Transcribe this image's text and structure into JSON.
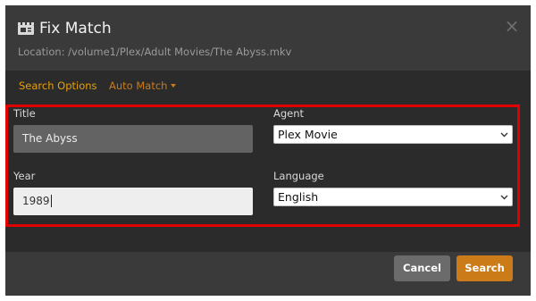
{
  "dialog": {
    "title": "Fix Match",
    "location": "Location: /volume1/Plex/Adult Movies/The Abyss.mkv",
    "close_icon": "close-icon",
    "title_icon": "clapperboard-icon"
  },
  "tabs": [
    {
      "label": "Search Options",
      "active": true
    },
    {
      "label": "Auto Match",
      "has_caret": true
    }
  ],
  "form": {
    "title_label": "Title",
    "title_value": "The Abyss",
    "year_label": "Year",
    "year_value": "1989",
    "agent_label": "Agent",
    "agent_value": "Plex Movie",
    "language_label": "Language",
    "language_value": "English"
  },
  "footer": {
    "cancel_label": "Cancel",
    "search_label": "Search"
  },
  "colors": {
    "accent": "#cc7b19",
    "tab_active": "#e5a00d",
    "highlight": "#e00000",
    "dialog_bg": "#3a3a3a",
    "panel_bg": "#2b2b2b"
  }
}
